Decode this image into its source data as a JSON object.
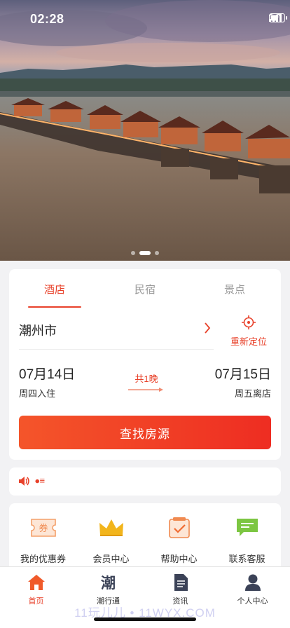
{
  "status_bar": {
    "time": "02:28",
    "icons": [
      "signal-icon",
      "wifi-icon",
      "battery-icon"
    ]
  },
  "banner": {
    "image": "bridge-river-photo",
    "page_count": 3,
    "active_page": 2
  },
  "booking": {
    "tabs": [
      {
        "label": "酒店",
        "active": true
      },
      {
        "label": "民宿",
        "active": false
      },
      {
        "label": "景点",
        "active": false
      }
    ],
    "city": "潮州市",
    "relocate_label": "重新定位",
    "checkin_date": "07月14日",
    "checkin_day": "周四入住",
    "nights": "共1晚",
    "checkout_date": "07月15日",
    "checkout_day": "周五离店",
    "search_label": "查找房源"
  },
  "notice": {
    "icon": "speaker-icon",
    "text": "⦁≡"
  },
  "services": [
    {
      "label": "我的优惠券",
      "icon": "coupon-icon",
      "icon_text": "券"
    },
    {
      "label": "会员中心",
      "icon": "crown-icon"
    },
    {
      "label": "帮助中心",
      "icon": "checklist-icon"
    },
    {
      "label": "联系客服",
      "icon": "chat-icon"
    }
  ],
  "tabbar": [
    {
      "label": "首页",
      "icon": "home-icon",
      "active": true
    },
    {
      "label": "潮行通",
      "icon": "chao-icon",
      "icon_text": "潮",
      "active": false
    },
    {
      "label": "资讯",
      "icon": "document-icon",
      "active": false
    },
    {
      "label": "个人中心",
      "icon": "user-icon",
      "active": false
    }
  ],
  "watermark": "11玩儿儿 • 11WYX.COM",
  "colors": {
    "accent": "#e8412a",
    "button_start": "#f4552a",
    "button_end": "#ee2d22",
    "gold": "#f2b51c",
    "green": "#7cc642",
    "background": "#f2f2f4"
  }
}
